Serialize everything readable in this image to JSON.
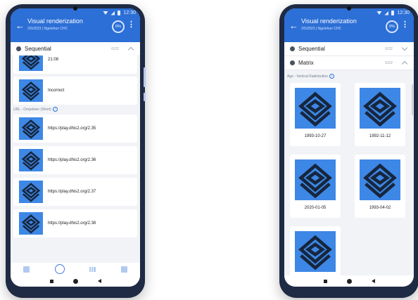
{
  "left": {
    "status_time": "12:30",
    "app_title": "Visual renderization",
    "app_subtitle": "2/5/2023 | Ngelehun CHC",
    "progress": "0%",
    "section": {
      "label": "Sequential",
      "count": "0/22"
    },
    "items_top": [
      {
        "label": "21:08"
      },
      {
        "label": "Incorrect"
      }
    ],
    "field_label": "URL - Dropdown (Short)",
    "items": [
      {
        "label": "https://play.dhis2.org/2.35"
      },
      {
        "label": "https://play.dhis2.org/2.36"
      },
      {
        "label": "https://play.dhis2.org/2.37"
      },
      {
        "label": "https://play.dhis2.org/2.38"
      }
    ],
    "nav_icons": [
      "clipboard-icon",
      "form-icon",
      "bar-chart-icon",
      "notes-icon"
    ]
  },
  "right": {
    "status_time": "12:30",
    "app_title": "Visual renderization",
    "app_subtitle": "2/5/2023 | Ngelehun CHC",
    "progress": "0%",
    "sections": [
      {
        "label": "Sequential",
        "count": "0/22"
      },
      {
        "label": "Matrix",
        "count": "0/22"
      }
    ],
    "field_label": "Age - Vertical Radiobutton",
    "tiles": [
      {
        "label": "1993-10-27"
      },
      {
        "label": "1992-11-12"
      },
      {
        "label": "2020-01-05"
      },
      {
        "label": "1993-04-02"
      },
      {
        "label": ""
      }
    ]
  },
  "colors": {
    "primary": "#2c6fd6",
    "tile": "#3d87e6",
    "background": "#f1f3f6"
  }
}
